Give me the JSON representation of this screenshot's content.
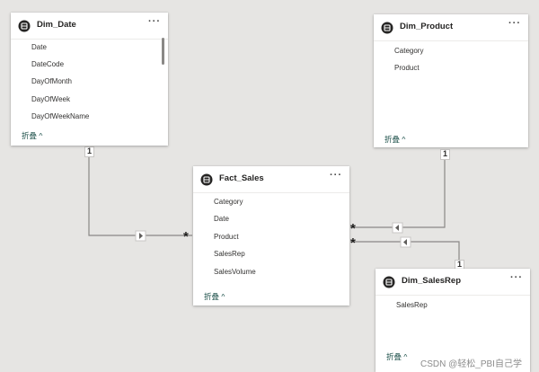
{
  "tables": {
    "dim_date": {
      "name": "Dim_Date",
      "fields": [
        "Date",
        "DateCode",
        "DayOfMonth",
        "DayOfWeek",
        "DayOfWeekName"
      ],
      "collapse_label": "折叠 ^"
    },
    "dim_product": {
      "name": "Dim_Product",
      "fields": [
        "Category",
        "Product"
      ],
      "collapse_label": "折叠 ^"
    },
    "fact_sales": {
      "name": "Fact_Sales",
      "fields": [
        "Category",
        "Date",
        "Product",
        "SalesRep",
        "SalesVolume"
      ],
      "collapse_label": "折叠 ^"
    },
    "dim_salesrep": {
      "name": "Dim_SalesRep",
      "fields": [
        "SalesRep"
      ],
      "collapse_label": "折叠 ^"
    }
  },
  "more_label": "···",
  "relationships": [
    {
      "from_table": "Dim_Date",
      "to_table": "Fact_Sales",
      "from_cardinality": "1",
      "to_cardinality": "*",
      "direction_icon": "arrow-right-icon"
    },
    {
      "from_table": "Dim_Product",
      "to_table": "Fact_Sales",
      "from_cardinality": "1",
      "to_cardinality": "*",
      "direction_icon": "arrow-left-icon"
    },
    {
      "from_table": "Dim_SalesRep",
      "to_table": "Fact_Sales",
      "from_cardinality": "1",
      "to_cardinality": "*",
      "direction_icon": "arrow-left-icon"
    }
  ],
  "watermark": "CSDN @轻松_PBI自己学",
  "colors": {
    "canvas": "#e6e5e3",
    "card": "#ffffff",
    "link_text": "#1b4f48",
    "connector": "#8a8886"
  }
}
